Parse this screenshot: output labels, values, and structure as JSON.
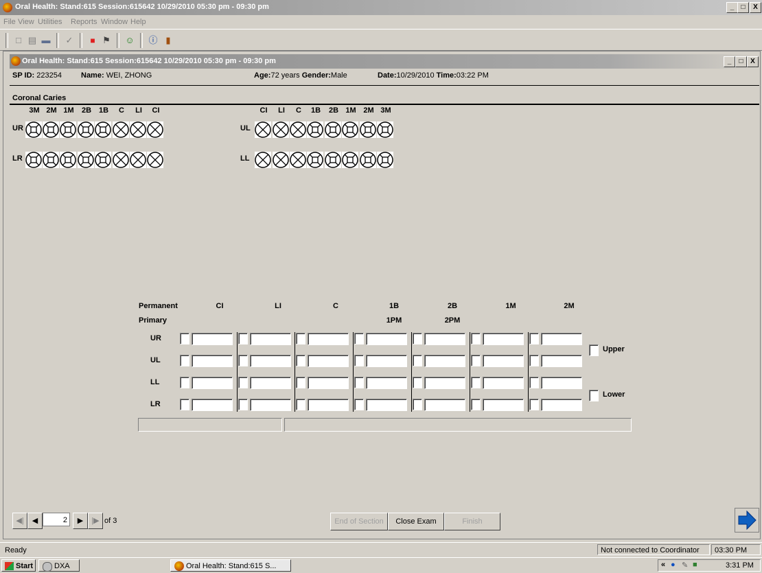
{
  "window": {
    "title": "Oral Health: Stand:615 Session:615642 10/29/2010 05:30 pm - 09:30 pm",
    "min": "_",
    "max": "□",
    "close": "X"
  },
  "menu": [
    "File",
    "View",
    "Utilities",
    "Reports",
    "Window",
    "Help"
  ],
  "inner_window": {
    "title": "Oral Health: Stand:615 Session:615642 10/29/2010 05:30 pm - 09:30 pm"
  },
  "patient": {
    "sp_id_label": "SP ID:",
    "sp_id": "223254",
    "name_label": "Name:",
    "name": "WEI, ZHONG",
    "age_label": "Age:",
    "age": "72 years",
    "gender_label": "Gender:",
    "gender": "Male",
    "date_label": "Date:",
    "date": "10/29/2010",
    "time_label": "Time:",
    "time": "03:22 PM"
  },
  "section_title": "Coronal Caries",
  "teeth": {
    "right_labels": [
      "3M",
      "2M",
      "1M",
      "2B",
      "1B",
      "C",
      "LI",
      "CI"
    ],
    "left_labels": [
      "CI",
      "LI",
      "C",
      "1B",
      "2B",
      "1M",
      "2M",
      "3M"
    ],
    "quadrants": {
      "ur": "UR",
      "ul": "UL",
      "lr": "LR",
      "ll": "LL"
    }
  },
  "grid": {
    "permanent_label": "Permanent",
    "primary_label": "Primary",
    "permanent_cols": [
      "CI",
      "LI",
      "C",
      "1B",
      "2B",
      "1M",
      "2M"
    ],
    "primary_cols": [
      "",
      "",
      "",
      "1PM",
      "2PM",
      "",
      ""
    ],
    "rows": [
      "UR",
      "UL",
      "LL",
      "LR"
    ],
    "upper_label": "Upper",
    "lower_label": "Lower"
  },
  "nav": {
    "page": "2",
    "of": "of 3"
  },
  "buttons": {
    "end_of_section": "End of Section",
    "close_exam": "Close Exam",
    "finish": "Finish"
  },
  "statusbar": {
    "status": "Ready",
    "connection": "Not connected to Coordinator",
    "time": "03:30 PM"
  },
  "taskbar": {
    "start": "Start",
    "task1": "DXA",
    "task2": "Oral Health: Stand:615 S...",
    "clock": "3:31 PM"
  }
}
